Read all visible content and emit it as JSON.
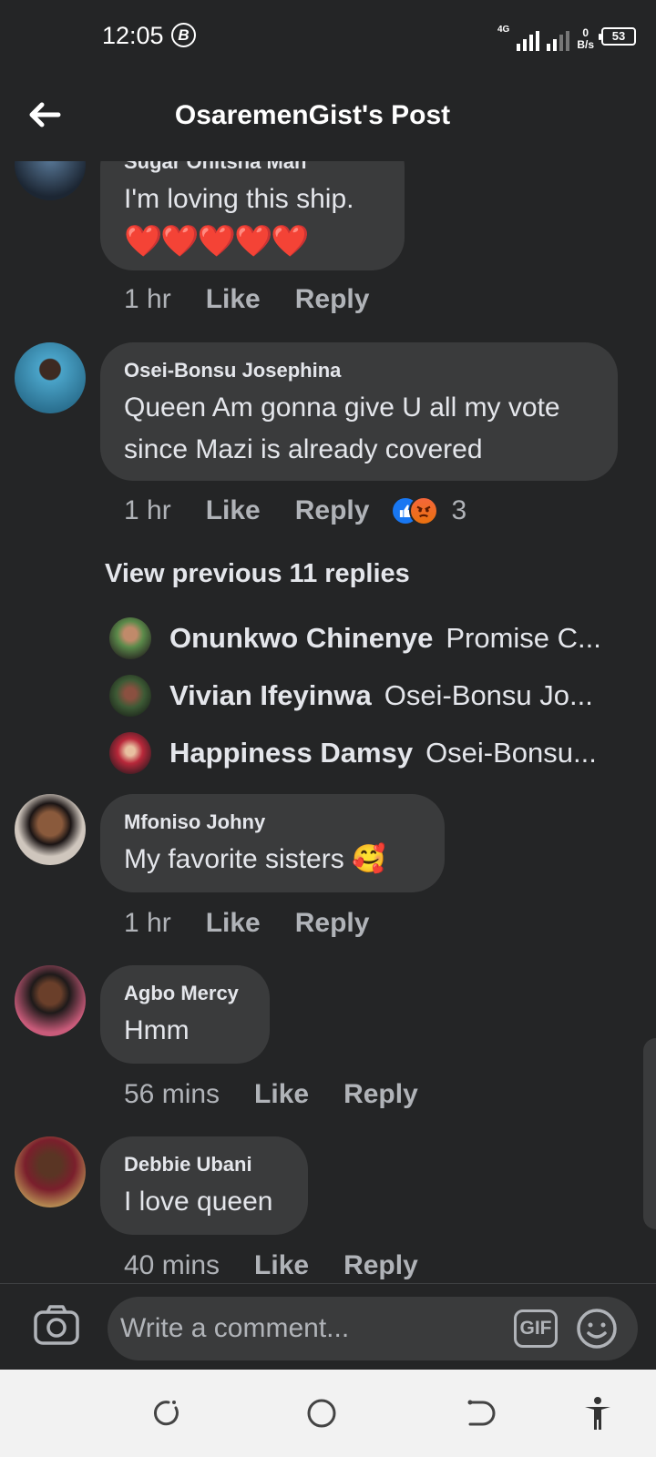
{
  "status_bar": {
    "time": "12:05",
    "b_badge": "B",
    "network": "4G",
    "speed_value": "0",
    "speed_unit": "B/s",
    "battery": "53"
  },
  "header": {
    "title": "OsaremenGist's Post"
  },
  "comments": [
    {
      "author": "Sugar Onitsha Man",
      "text": "I'm loving this ship.",
      "hearts": "❤️❤️❤️❤️❤️",
      "time": "1 hr",
      "like": "Like",
      "reply": "Reply"
    },
    {
      "author": "Osei-Bonsu Josephina",
      "text_line1": "Queen Am gonna give U all my vote",
      "text_line2": "since Mazi is already covered",
      "time": "1 hr",
      "like": "Like",
      "reply": "Reply",
      "reaction_count": "3"
    },
    {
      "author": "Mfoniso Johny",
      "text": "My favorite sisters",
      "emoji": "🥰",
      "time": "1 hr",
      "like": "Like",
      "reply": "Reply"
    },
    {
      "author": "Agbo Mercy",
      "text": "Hmm",
      "time": "56 mins",
      "like": "Like",
      "reply": "Reply"
    },
    {
      "author": "Debbie Ubani",
      "text": "I love queen",
      "time": "40 mins",
      "like": "Like",
      "reply": "Reply"
    }
  ],
  "view_previous": "View previous 11 replies",
  "replies": [
    {
      "author": "Onunkwo Chinenye",
      "preview": "Promise C..."
    },
    {
      "author": "Vivian Ifeyinwa",
      "preview": "Osei-Bonsu Jo..."
    },
    {
      "author": "Happiness Damsy",
      "preview": "Osei-Bonsu..."
    }
  ],
  "composer": {
    "placeholder": "Write a comment...",
    "gif_label": "GIF"
  },
  "colors": {
    "background": "#242526",
    "bubble": "#3a3b3c",
    "text": "#e4e6eb",
    "muted": "#b0b3b8",
    "like_blue": "#1877f2"
  }
}
